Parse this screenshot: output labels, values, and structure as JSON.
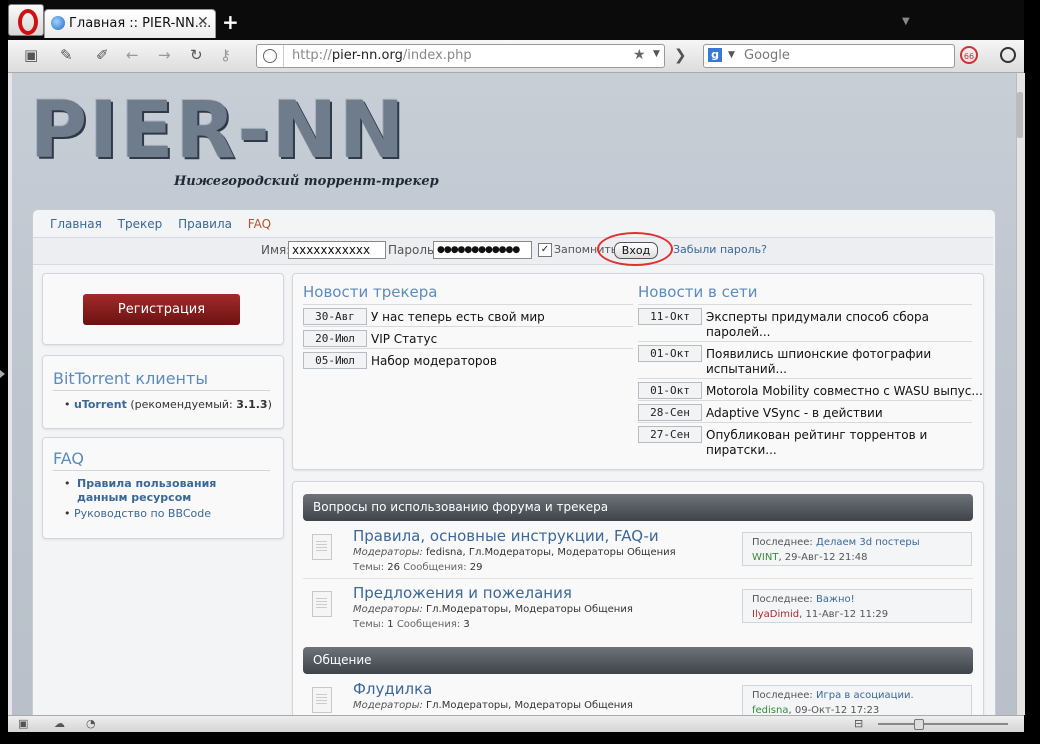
{
  "browser": {
    "tab_title": "Главная :: PIER-NN....",
    "tab_close": "✕",
    "new_tab": "+",
    "url_prefix": "http://",
    "url_domain": "pier-nn.org",
    "url_path": "/index.php",
    "search_placeholder": "Google",
    "search_engine_letter": "g"
  },
  "site": {
    "logo_text": "PIER-NN",
    "logo_subtitle": "Нижегородский торрент-трекер"
  },
  "nav": {
    "items": [
      "Главная",
      "Трекер",
      "Правила",
      "FAQ"
    ]
  },
  "login": {
    "username_label": "Имя:",
    "username_value": "xxxxxxxxxxx",
    "password_label": "Пароль:",
    "password_value": "●●●●●●●●●●●●",
    "remember_label": "Запомнить",
    "remember_checked": "✓",
    "submit_label": "Вход",
    "forgot_label": "Забыли пароль?"
  },
  "sidebar": {
    "register_label": "Регистрация",
    "bittorrent": {
      "title": "BitTorrent клиенты",
      "client_name": "uTorrent",
      "client_note": " (рекомендуемый: ",
      "client_version": "3.1.3",
      "client_close": ")"
    },
    "faq": {
      "title": "FAQ",
      "links": [
        "Правила пользования данным ресурсом",
        "Руководство по BBCode"
      ]
    }
  },
  "news": {
    "tracker": {
      "title": "Новости трекера",
      "items": [
        {
          "date": "30-Авг",
          "text": "У нас теперь есть свой мир"
        },
        {
          "date": "20-Июл",
          "text": "VIP Статус"
        },
        {
          "date": "05-Июл",
          "text": "Набор модераторов"
        }
      ]
    },
    "web": {
      "title": "Новости в сети",
      "items": [
        {
          "date": "11-Окт",
          "line1": "Эксперты придумали способ сбора",
          "line2": "паролей..."
        },
        {
          "date": "01-Окт",
          "line1": "Появились шпионские фотографии",
          "line2": "испытаний..."
        },
        {
          "date": "01-Окт",
          "line1": "Motorola Mobility совместно с WASU выпус...",
          "line2": ""
        },
        {
          "date": "28-Сен",
          "line1": "Adaptive VSync - в действии",
          "line2": ""
        },
        {
          "date": "27-Сен",
          "line1": "Опубликован рейтинг торрентов и",
          "line2": "пиратски..."
        }
      ]
    }
  },
  "forums": {
    "categories": [
      {
        "title": "Вопросы по использованию форума и трекера",
        "forums": [
          {
            "title": "Правила, основные инструкции, FAQ-и",
            "mods_label": "Модераторы:",
            "mods": "fedisna, Гл.Модераторы, Модераторы Общения",
            "topics_label": "Темы:",
            "topics": "26",
            "posts_label": "Сообщения:",
            "posts": "29",
            "last_label": "Последнее:",
            "last_topic": "Делаем 3d постеры",
            "last_user": "WINT",
            "last_date": ", 29-Авг-12 21:48"
          },
          {
            "title": "Предложения и пожелания",
            "mods_label": "Модераторы:",
            "mods": "Гл.Модераторы, Модераторы Общения",
            "topics_label": "Темы:",
            "topics": "1",
            "posts_label": "Сообщения:",
            "posts": "3",
            "last_label": "Последнее:",
            "last_topic": "Важно!",
            "last_user": "IlyaDimid",
            "last_date": ", 11-Авг-12 11:29"
          }
        ]
      },
      {
        "title": "Общение",
        "forums": [
          {
            "title": "Флудилка",
            "mods_label": "Модераторы:",
            "mods": "Гл.Модераторы, Модераторы Общения",
            "last_label": "Последнее:",
            "last_topic": "Игра в асоциации.",
            "last_user": "fedisna",
            "last_date": ", 09-Окт-12 17:23"
          }
        ]
      }
    ]
  },
  "colors": {
    "link": "#3a6898",
    "heading": "#5b8cbf",
    "register_button": "#8b1e1e",
    "highlight_circle": "#e03030"
  }
}
